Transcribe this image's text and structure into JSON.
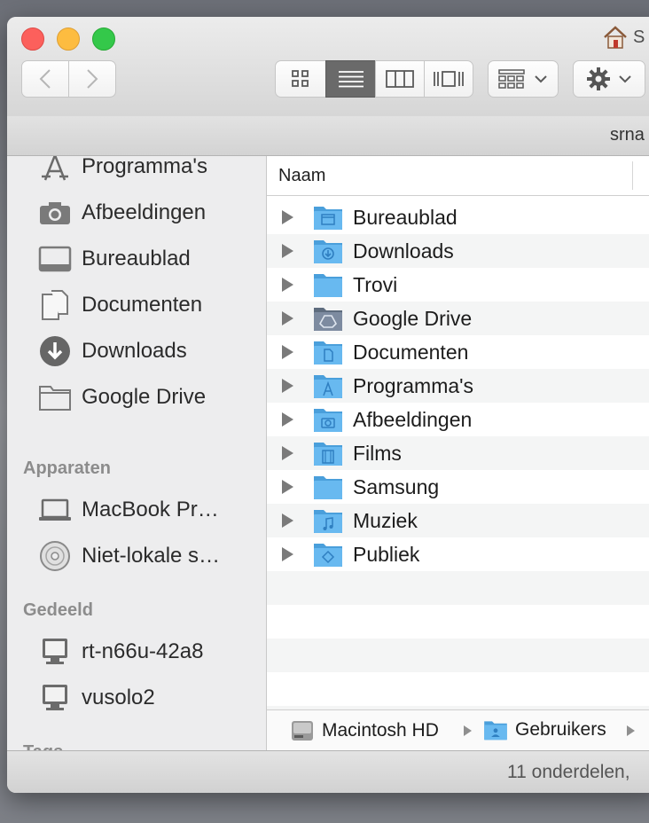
{
  "window": {
    "title": "S",
    "path_user": "srna"
  },
  "toolbar": {
    "back_icon": "chevron-left-icon",
    "forward_icon": "chevron-right-icon",
    "views": [
      "icon-view-icon",
      "list-view-icon",
      "column-view-icon",
      "coverflow-view-icon"
    ],
    "selected_view": "list",
    "arrange_icon": "arrange-grid-icon",
    "action_icon": "gear-icon"
  },
  "sidebar": {
    "favorites": [
      {
        "label": "Programma's",
        "icon": "applications-icon"
      },
      {
        "label": "Afbeeldingen",
        "icon": "camera-icon"
      },
      {
        "label": "Bureaublad",
        "icon": "desktop-icon"
      },
      {
        "label": "Documenten",
        "icon": "documents-icon"
      },
      {
        "label": "Downloads",
        "icon": "download-icon"
      },
      {
        "label": "Google Drive",
        "icon": "folder-icon"
      }
    ],
    "devices_header": "Apparaten",
    "devices": [
      {
        "label": "MacBook Pr…",
        "icon": "laptop-icon"
      },
      {
        "label": "Niet-lokale s…",
        "icon": "disc-icon"
      }
    ],
    "shared_header": "Gedeeld",
    "shared": [
      {
        "label": "rt-n66u-42a8",
        "icon": "monitor-icon"
      },
      {
        "label": "vusolo2",
        "icon": "monitor-icon"
      }
    ],
    "tags_header": "Tags"
  },
  "list": {
    "column_name": "Naam",
    "items": [
      {
        "name": "Bureaublad",
        "badge": "desktop"
      },
      {
        "name": "Downloads",
        "badge": "download"
      },
      {
        "name": "Trovi",
        "badge": "none"
      },
      {
        "name": "Google Drive",
        "badge": "drive"
      },
      {
        "name": "Documenten",
        "badge": "document"
      },
      {
        "name": "Programma's",
        "badge": "apps"
      },
      {
        "name": "Afbeeldingen",
        "badge": "camera"
      },
      {
        "name": "Films",
        "badge": "film"
      },
      {
        "name": "Samsung",
        "badge": "none"
      },
      {
        "name": "Muziek",
        "badge": "music"
      },
      {
        "name": "Publiek",
        "badge": "public"
      }
    ]
  },
  "pathbar": {
    "crumbs": [
      "Macintosh HD",
      "Gebruikers"
    ]
  },
  "status": {
    "text": "11 onderdelen,"
  },
  "colors": {
    "folder": "#68b9f0",
    "folder_dark": "#4a9fdb",
    "selected_view_bg": "#6a6a6a"
  }
}
